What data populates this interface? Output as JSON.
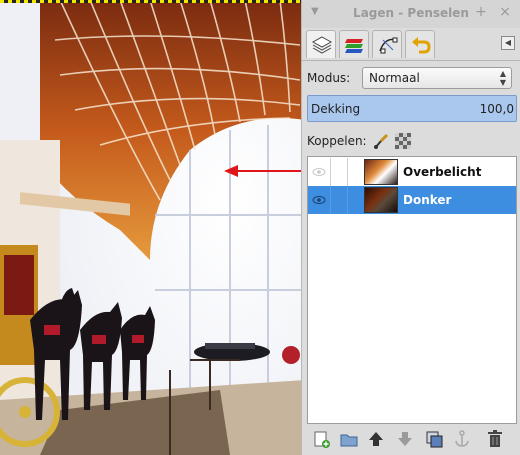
{
  "panel": {
    "title": "Lagen - Penselen",
    "tabs": [
      {
        "name": "layers-tab",
        "icon": "layers-icon"
      },
      {
        "name": "channels-tab",
        "icon": "channels-icon"
      },
      {
        "name": "paths-tab",
        "icon": "paths-icon"
      },
      {
        "name": "undo-tab",
        "icon": "undo-history-icon"
      }
    ]
  },
  "mode": {
    "label": "Modus:",
    "value": "Normaal"
  },
  "opacity": {
    "label": "Dekking",
    "value": "100,0"
  },
  "lock": {
    "label": "Koppelen:"
  },
  "layers": [
    {
      "name": "Overbelicht",
      "visible": false,
      "selected": false
    },
    {
      "name": "Donker",
      "visible": true,
      "selected": true
    }
  ],
  "bottom_actions": [
    "new-layer-icon",
    "new-layer-group-icon",
    "raise-layer-icon",
    "lower-layer-icon",
    "duplicate-layer-icon",
    "anchor-layer-icon",
    "delete-layer-icon"
  ],
  "colors": {
    "selection": "#3d8ee0",
    "opacity_bar": "#aac8ee",
    "annotation_arrow": "#e0151a"
  }
}
